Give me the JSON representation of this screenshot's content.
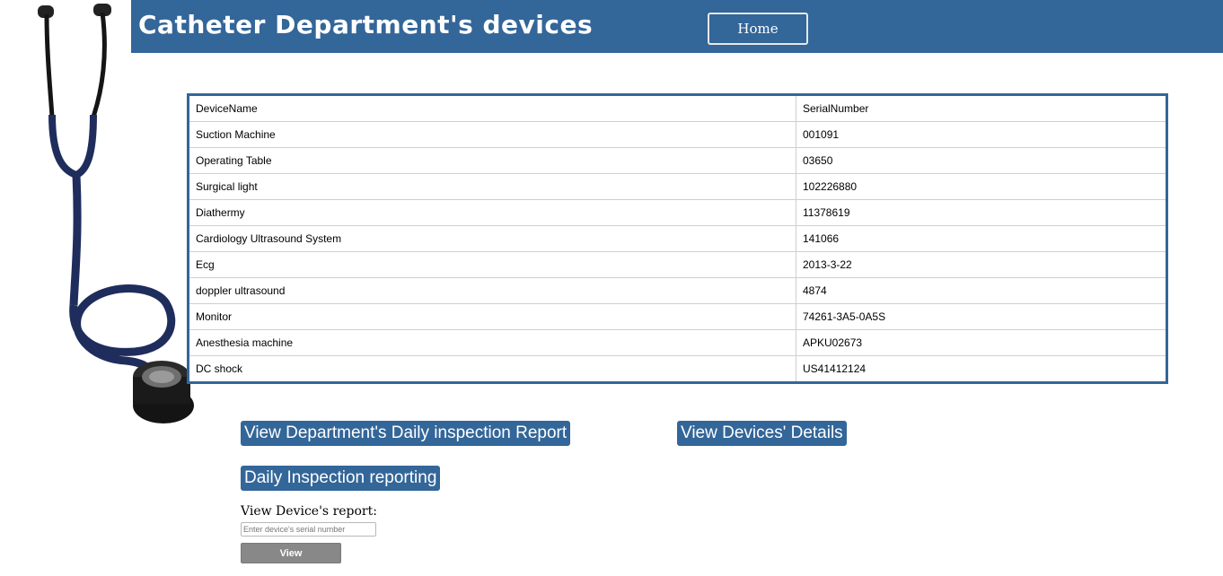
{
  "header": {
    "title": "Catheter Department's devices",
    "home_label": "Home"
  },
  "devices_table": {
    "headers": [
      "DeviceName",
      "SerialNumber"
    ],
    "rows": [
      [
        "Suction Machine",
        "001091"
      ],
      [
        "Operating Table",
        "03650"
      ],
      [
        "Surgical light",
        "102226880"
      ],
      [
        "Diathermy",
        "11378619"
      ],
      [
        "Cardiology Ultrasound System",
        "141066"
      ],
      [
        "Ecg",
        "2013-3-22"
      ],
      [
        "doppler ultrasound",
        "4874"
      ],
      [
        "Monitor",
        "74261-3A5-0A5S"
      ],
      [
        "Anesthesia machine",
        "APKU02673"
      ],
      [
        "DC shock",
        "US41412124"
      ]
    ]
  },
  "actions": {
    "daily_report_label": "View Department's Daily inspection Report",
    "devices_details_label": "View Devices' Details",
    "daily_reporting_label": "Daily Inspection reporting"
  },
  "device_report": {
    "label": "View Device's report:",
    "input_placeholder": "Enter device's serial number",
    "input_value": "",
    "view_label": "View"
  },
  "colors": {
    "brand": "#336699",
    "view_button": "#888888"
  },
  "icons": {
    "decoration": "stethoscope-icon"
  }
}
